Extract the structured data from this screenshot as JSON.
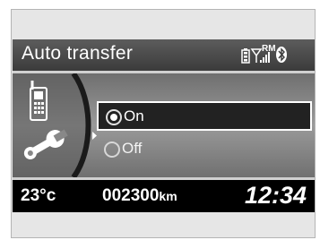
{
  "header": {
    "title": "Auto transfer",
    "roaming_label": "RM",
    "icons": [
      "phone-battery-icon",
      "signal-strength-icon",
      "bluetooth-icon"
    ]
  },
  "menu": {
    "options": [
      {
        "label": "On",
        "selected": true,
        "highlighted": true
      },
      {
        "label": "Off",
        "selected": false,
        "highlighted": false
      }
    ],
    "category_icons": [
      "phone-icon",
      "wrench-icon",
      "selection-arrow-icon"
    ]
  },
  "footer": {
    "temperature": "23°c",
    "odometer_value": "002300",
    "odometer_unit": "km",
    "clock": "12:34"
  },
  "colors": {
    "screen_background": "#000000",
    "header_gradient_top": "#5c5c5c",
    "body_gradient_mid": "#9a9a9a",
    "text": "#ffffff",
    "divider": "#d0d0d0"
  }
}
